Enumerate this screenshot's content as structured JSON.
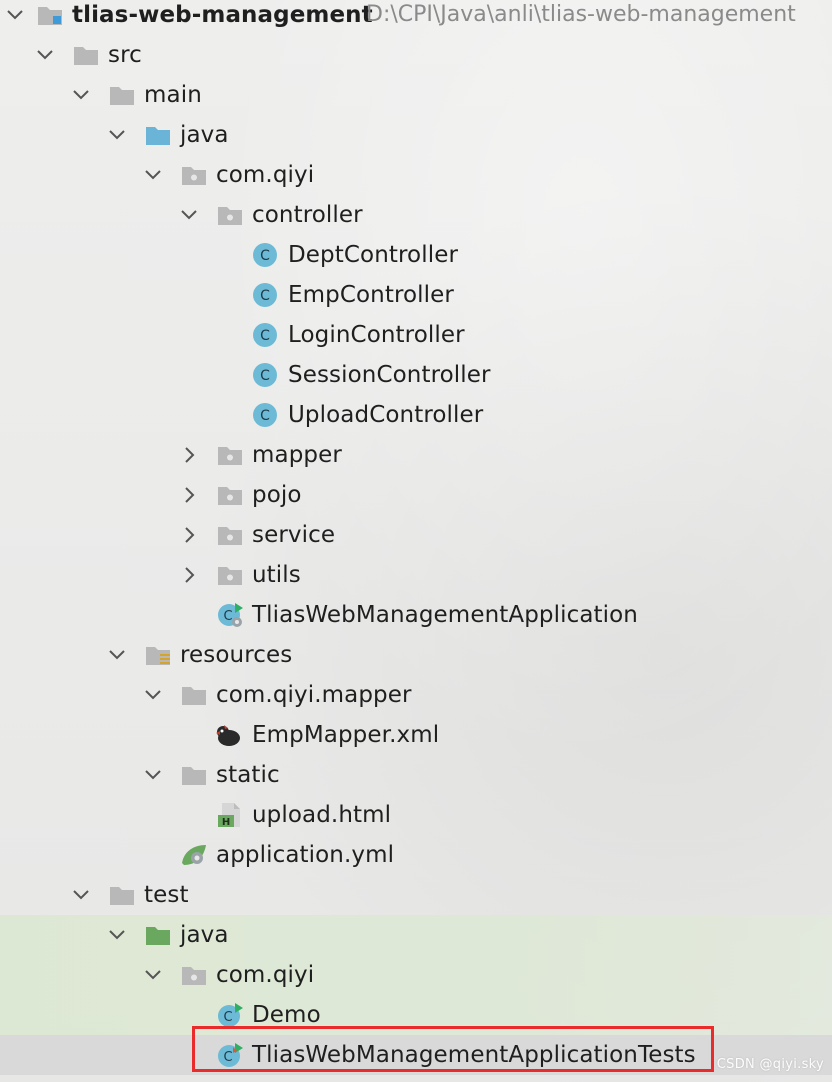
{
  "project": {
    "name": "tlias-web-management",
    "path": "D:\\CPI\\Java\\anli\\tlias-web-management"
  },
  "tree": {
    "src": "src",
    "main": "main",
    "main_java": "java",
    "com_qiyi": "com.qiyi",
    "controller": "controller",
    "controllers": [
      "DeptController",
      "EmpController",
      "LoginController",
      "SessionController",
      "UploadController"
    ],
    "mapper": "mapper",
    "pojo": "pojo",
    "service": "service",
    "utils": "utils",
    "application_class": "TliasWebManagementApplication",
    "resources": "resources",
    "resources_package": "com.qiyi.mapper",
    "mapper_xml": "EmpMapper.xml",
    "static": "static",
    "upload_html": "upload.html",
    "application_yml": "application.yml",
    "test": "test",
    "test_java": "java",
    "test_package": "com.qiyi",
    "demo": "Demo",
    "tests_class": "TliasWebManagementApplicationTests"
  },
  "watermark": "CSDN @qiyi.sky",
  "colors": {
    "folder": "#b8b8b8",
    "source_folder": "#6ab4d8",
    "test_folder": "#6aa860",
    "class_icon": "#6cbad6",
    "run_marker": "#2faf63",
    "selection": "#d9d9d9",
    "highlight": "#ea2b2b"
  }
}
